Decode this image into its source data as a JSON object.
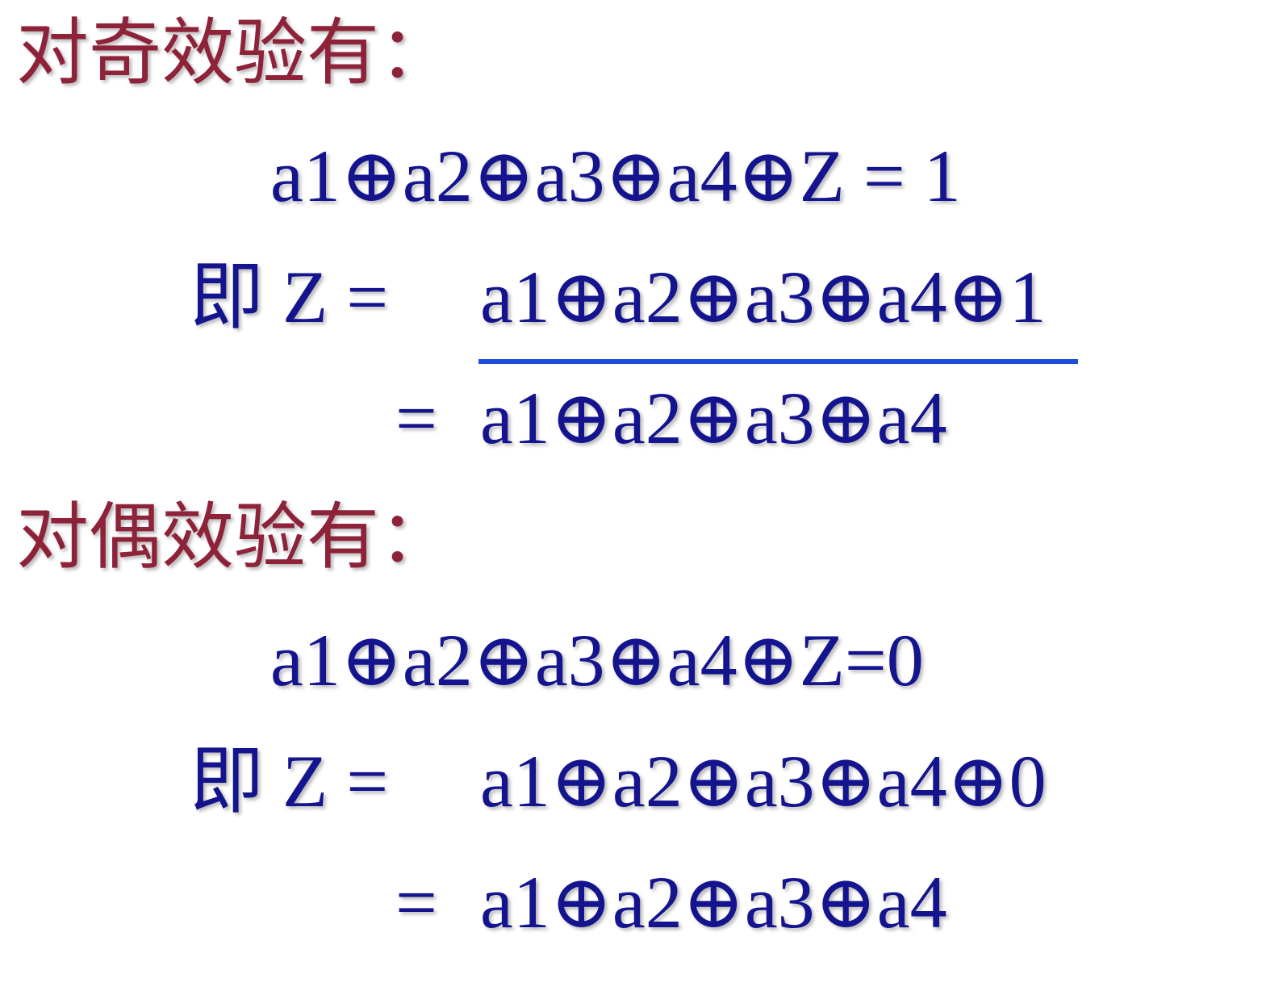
{
  "colors": {
    "heading": "#8e2238",
    "formula": "#14148f",
    "overbar": "#1d4ed8"
  },
  "odd": {
    "heading": "对奇效验有：",
    "equation": "a1⊕a2⊕a3⊕a4⊕Z = 1",
    "z_prefix": "即 Z =",
    "z_expr": "a1⊕a2⊕a3⊕a4⊕1",
    "eq_prefix": "=",
    "eq_expr": "a1⊕a2⊕a3⊕a4"
  },
  "even": {
    "heading": "对偶效验有：",
    "equation": "a1⊕a2⊕a3⊕a4⊕Z=0",
    "z_prefix": "即 Z =",
    "z_expr": "a1⊕a2⊕a3⊕a4⊕0",
    "eq_prefix": "=",
    "eq_expr": "a1⊕a2⊕a3⊕a4"
  }
}
